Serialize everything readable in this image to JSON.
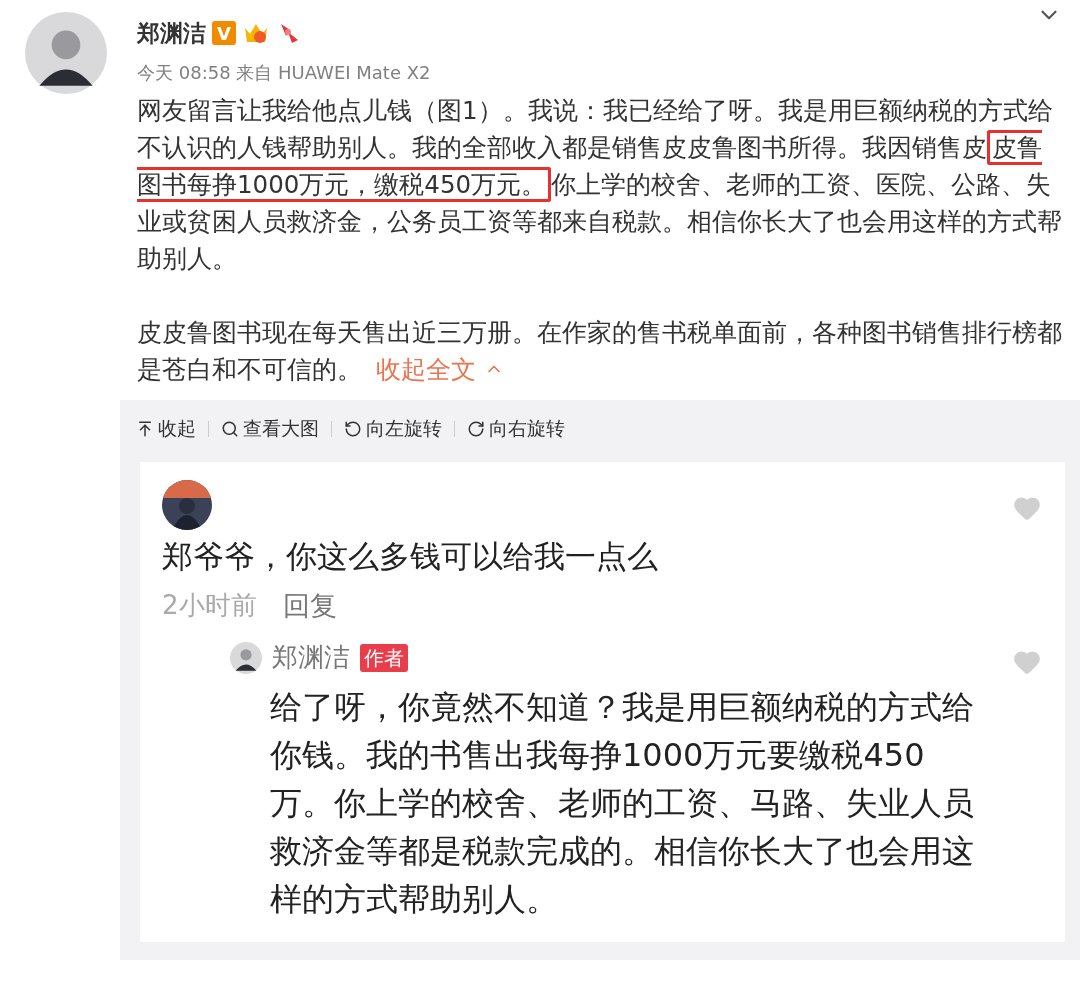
{
  "post": {
    "author": "郑渊洁",
    "badge": "V",
    "meta": "今天 08:58 来自 HUAWEI Mate X2",
    "paragraphs": [
      {
        "before": "网友留言让我给他点儿钱（图1）。我说：我已经给了呀。我是用巨额纳税的方式给不认识的人钱帮助别人。我的全部收入都是销售皮皮鲁图书所得。我因销售皮",
        "boxed": "皮鲁图书每挣1000万元，缴税450万元。",
        "after": "你上学的校舍、老师的工资、医院、公路、失业或贫困人员救济金，公务员工资等都来自税款。相信你长大了也会用这样的方式帮助别人。"
      },
      {
        "before": "皮皮鲁图书现在每天售出近三万册。在作家的售书税单面前，各种图书销售排行榜都是苍白和不可信的。"
      }
    ],
    "collapse_link": "收起全文"
  },
  "toolbar": [
    {
      "kind": "collapse",
      "label": "收起"
    },
    {
      "kind": "zoom",
      "label": "查看大图"
    },
    {
      "kind": "rotate-left",
      "label": "向左旋转"
    },
    {
      "kind": "rotate-right",
      "label": "向右旋转"
    }
  ],
  "image": {
    "comment": {
      "text": "郑爷爷，你这么多钱可以给我一点么",
      "time": "2小时前",
      "reply_action": "回复"
    },
    "reply": {
      "author": "郑渊洁",
      "tag": "作者",
      "text": "给了呀，你竟然不知道？我是用巨额纳税的方式给你钱。我的书售出我每挣1000万元要缴税450万。你上学的校舍、老师的工资、马路、失业人员救济金等都是税款完成的。相信你长大了也会用这样的方式帮助别人。"
    }
  }
}
